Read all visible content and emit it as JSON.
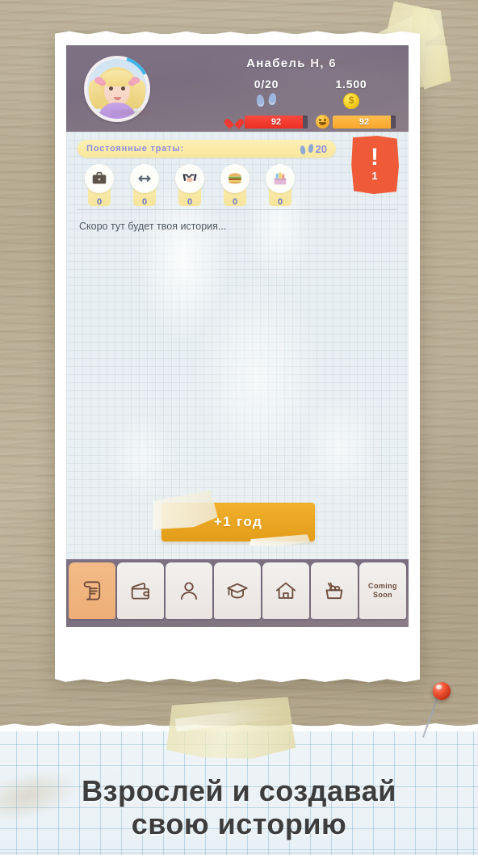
{
  "header": {
    "character_name": "Анабель Н, 6",
    "avatar_icon": "girl-avatar",
    "stats": [
      {
        "id": "steps",
        "value": "0/20",
        "icon": "footsteps-icon"
      },
      {
        "id": "money",
        "value": "1.500",
        "icon": "coin-icon"
      }
    ],
    "bars": [
      {
        "id": "health",
        "icon": "heart-pulse-icon",
        "value": "92",
        "percent": 92,
        "color": "#ec2f24"
      },
      {
        "id": "happiness",
        "icon": "smiley-icon",
        "value": "92",
        "percent": 92,
        "color": "#f9a72c"
      }
    ]
  },
  "expenses": {
    "label": "Постоянные траты:",
    "total_steps": "20",
    "steps_icon": "footsteps-icon",
    "items": [
      {
        "icon": "briefcase-icon",
        "value": "0"
      },
      {
        "icon": "dumbbell-icon",
        "value": "0"
      },
      {
        "icon": "handshake-icon",
        "value": "0"
      },
      {
        "icon": "burger-icon",
        "value": "0"
      },
      {
        "icon": "groceries-icon",
        "value": "0"
      }
    ]
  },
  "alert": {
    "icon": "exclamation-icon",
    "count": "1"
  },
  "story": {
    "text": "Скоро тут будет твоя история..."
  },
  "action": {
    "next_year_label": "+1 год"
  },
  "nav": {
    "tabs": [
      {
        "icon": "scroll-icon",
        "label": "",
        "active": true
      },
      {
        "icon": "wallet-icon",
        "label": "",
        "active": false
      },
      {
        "icon": "person-icon",
        "label": "",
        "active": false
      },
      {
        "icon": "graduation-cap-icon",
        "label": "",
        "active": false
      },
      {
        "icon": "house-icon",
        "label": "",
        "active": false
      },
      {
        "icon": "shopping-basket-icon",
        "label": "",
        "active": false
      },
      {
        "icon": "coming-soon-text",
        "label": "Coming\nSoon",
        "active": false
      }
    ]
  },
  "tagline": {
    "line1": "Взрослей и создавай",
    "line2": "свою историю"
  },
  "colors": {
    "header_bg": "#7a6e80",
    "accent_orange": "#e9a521",
    "alert_red": "#ef5b38",
    "health_red": "#ec2f24",
    "happy_orange": "#f9a72c",
    "desk_wood": "#b6aa90"
  }
}
